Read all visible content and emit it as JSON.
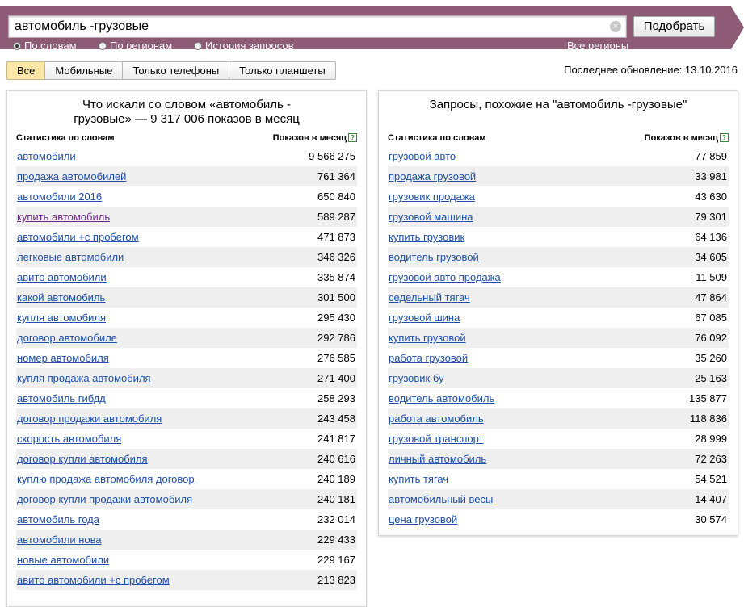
{
  "search": {
    "query": "автомобиль -грузовые",
    "submit_label": "Подобрать",
    "modes": [
      {
        "label": "По словам",
        "selected": true
      },
      {
        "label": "По регионам",
        "selected": false
      },
      {
        "label": "История запросов",
        "selected": false
      }
    ],
    "regions_link": "Все регионы"
  },
  "tabs": [
    {
      "label": "Все",
      "active": true
    },
    {
      "label": "Мобильные",
      "active": false
    },
    {
      "label": "Только телефоны",
      "active": false
    },
    {
      "label": "Только планшеты",
      "active": false
    }
  ],
  "last_update": "Последнее обновление: 13.10.2016",
  "left_panel": {
    "title": "Что искали со словом «автомобиль - грузовые» — 9 317 006 показов в месяц",
    "col_keyword": "Статистика по словам",
    "col_count": "Показов в месяц",
    "rows": [
      {
        "keyword": "автомобили",
        "count": "9 566 275"
      },
      {
        "keyword": "продажа автомобилей",
        "count": "761 364"
      },
      {
        "keyword": "автомобили 2016",
        "count": "650 840"
      },
      {
        "keyword": "купить автомобиль",
        "count": "589 287",
        "visited": true
      },
      {
        "keyword": "автомобили +с пробегом",
        "count": "471 873"
      },
      {
        "keyword": "легковые автомобили",
        "count": "346 326"
      },
      {
        "keyword": "авито автомобили",
        "count": "335 874"
      },
      {
        "keyword": "какой автомобиль",
        "count": "301 500"
      },
      {
        "keyword": "купля автомобиля",
        "count": "295 430"
      },
      {
        "keyword": "договор автомобиле",
        "count": "292 786"
      },
      {
        "keyword": "номер автомобиля",
        "count": "276 585"
      },
      {
        "keyword": "купля продажа автомобиля",
        "count": "271 400"
      },
      {
        "keyword": "автомобиль гибдд",
        "count": "258 293"
      },
      {
        "keyword": "договор продажи автомобиля",
        "count": "243 458"
      },
      {
        "keyword": "скорость автомобиля",
        "count": "241 817"
      },
      {
        "keyword": "договор купли автомобиля",
        "count": "240 616"
      },
      {
        "keyword": "куплю продажа автомобиля договор",
        "count": "240 189"
      },
      {
        "keyword": "договор купли продажи автомобиля",
        "count": "240 181"
      },
      {
        "keyword": "автомобиль года",
        "count": "232 014"
      },
      {
        "keyword": "автомобили нова",
        "count": "229 433"
      },
      {
        "keyword": "новые автомобили",
        "count": "229 167"
      },
      {
        "keyword": "авито автомобили +с пробегом",
        "count": "213 823"
      }
    ]
  },
  "right_panel": {
    "title": "Запросы, похожие на \"автомобиль -грузовые\"",
    "col_keyword": "Статистика по словам",
    "col_count": "Показов в месяц",
    "rows": [
      {
        "keyword": "грузовой авто",
        "count": "77 859"
      },
      {
        "keyword": "продажа грузовой",
        "count": "33 981"
      },
      {
        "keyword": "грузовик продажа",
        "count": "43 630"
      },
      {
        "keyword": "грузовой машина",
        "count": "79 301"
      },
      {
        "keyword": "купить грузовик",
        "count": "64 136"
      },
      {
        "keyword": "водитель грузовой",
        "count": "34 605"
      },
      {
        "keyword": "грузовой авто продажа",
        "count": "11 509"
      },
      {
        "keyword": "седельный тягач",
        "count": "47 864"
      },
      {
        "keyword": "грузовой шина",
        "count": "67 085"
      },
      {
        "keyword": "купить грузовой",
        "count": "76 092"
      },
      {
        "keyword": "работа грузовой",
        "count": "35 260"
      },
      {
        "keyword": "грузовик бу",
        "count": "25 163"
      },
      {
        "keyword": "водитель автомобиль",
        "count": "135 877"
      },
      {
        "keyword": "работа автомобиль",
        "count": "118 836"
      },
      {
        "keyword": "грузовой транспорт",
        "count": "28 999"
      },
      {
        "keyword": "личный автомобиль",
        "count": "72 263"
      },
      {
        "keyword": "купить тягач",
        "count": "54 521"
      },
      {
        "keyword": "автомобильный весы",
        "count": "14 407"
      },
      {
        "keyword": "цена грузовой",
        "count": "30 574"
      }
    ]
  }
}
